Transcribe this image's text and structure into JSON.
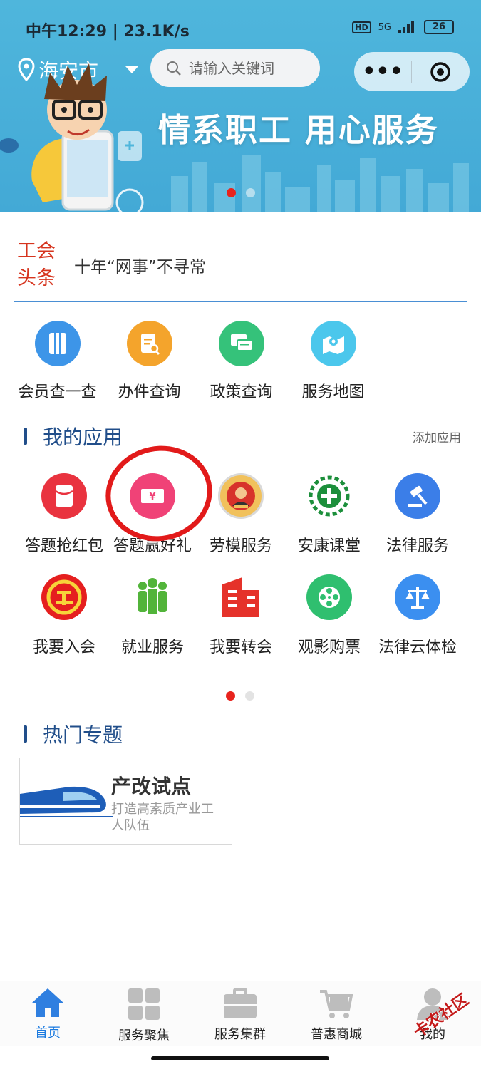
{
  "status_bar": {
    "time": "中午12:29 | 23.1K/s",
    "network": "5G",
    "hd": "HD",
    "battery": "26"
  },
  "header": {
    "city": "海安市",
    "search_placeholder": "请输入关键词",
    "more": "•••"
  },
  "banner": {
    "slogan": "情系职工  用心服务",
    "dots": 2,
    "active_dot": 0
  },
  "headline": {
    "tag": "工会头条",
    "text": "十年“网事”不寻常"
  },
  "quick_links": [
    {
      "label": "会员查一查",
      "icon": "book-icon",
      "color": "#3d95e8"
    },
    {
      "label": "办件查询",
      "icon": "clipboard-search-icon",
      "color": "#f4a42c"
    },
    {
      "label": "政策查询",
      "icon": "chat-icon",
      "color": "#35c27a"
    },
    {
      "label": "服务地图",
      "icon": "map-icon",
      "color": "#4bc7ec"
    }
  ],
  "my_apps": {
    "title": "我的应用",
    "add_label": "添加应用",
    "items": [
      {
        "label": "答题抢红包",
        "icon": "red-envelope-icon",
        "color": "#e9333f"
      },
      {
        "label": "答题赢好礼",
        "icon": "gift-ticket-icon",
        "color": "#f04277"
      },
      {
        "label": "劳模服务",
        "icon": "model-worker-medal-icon",
        "color": "#e5a23b"
      },
      {
        "label": "安康课堂",
        "icon": "health-cross-icon",
        "color": "#1c8f3b"
      },
      {
        "label": "法律服务",
        "icon": "gavel-icon",
        "color": "#3b7ee8"
      },
      {
        "label": "我要入会",
        "icon": "union-emblem-icon",
        "color": "#e51f1f"
      },
      {
        "label": "就业服务",
        "icon": "people-group-icon",
        "color": "#52b43a"
      },
      {
        "label": "我要转会",
        "icon": "building-icon",
        "color": "#e5322a"
      },
      {
        "label": "观影购票",
        "icon": "film-reel-icon",
        "color": "#2fbf6f"
      },
      {
        "label": "法律云体检",
        "icon": "scales-icon",
        "color": "#3b8ff0"
      }
    ]
  },
  "hot_topics": {
    "title": "热门专题",
    "card": {
      "title": "产改试点",
      "subtitle": "打造高素质产业工人队伍"
    }
  },
  "tabs": [
    {
      "label": "首页",
      "icon": "home-icon",
      "active": true
    },
    {
      "label": "服务聚焦",
      "icon": "grid-icon",
      "active": false
    },
    {
      "label": "服务集群",
      "icon": "briefcase-icon",
      "active": false
    },
    {
      "label": "普惠商城",
      "icon": "cart-icon",
      "active": false
    },
    {
      "label": "我的",
      "icon": "user-icon",
      "active": false
    }
  ],
  "watermark": "卡农社区",
  "colors": {
    "banner": "#4fb6dc",
    "accent": "#1a7ae0",
    "section": "#214e8a",
    "headline_tag": "#d6341e"
  }
}
